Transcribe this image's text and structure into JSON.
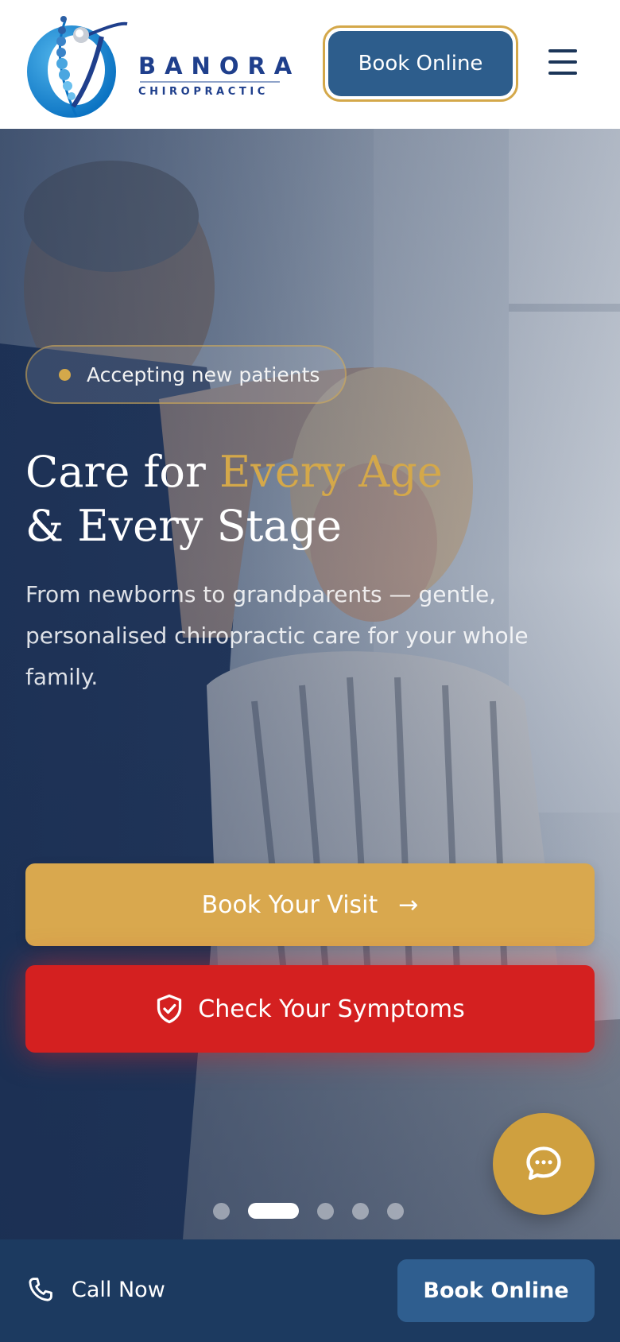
{
  "header": {
    "logo": {
      "name": "BANORA",
      "subtitle": "CHIROPRACTIC"
    },
    "book_label": "Book Online",
    "menu_icon": "hamburger-menu-icon"
  },
  "hero": {
    "badge": {
      "text": "Accepting new patients",
      "dot_color": "#d4a84a"
    },
    "headline": {
      "part1": "Care for ",
      "highlight": "Every Age",
      "part2": "& Every Stage"
    },
    "subtext": "From newborns to grandparents — gentle, personalised chiropractic care for your whole family.",
    "cta_primary": {
      "label": "Book Your Visit",
      "icon": "arrow-right-icon"
    },
    "cta_secondary": {
      "label": "Check Your Symptoms",
      "icon": "shield-check-icon"
    },
    "carousel": {
      "total": 5,
      "active": 2
    },
    "chat_icon": "chat-bubble-icon"
  },
  "bottom_bar": {
    "call_label": "Call Now",
    "call_icon": "phone-icon",
    "book_label": "Book Online"
  },
  "colors": {
    "brand_navy": "#1c3a60",
    "brand_blue": "#2d5d8c",
    "gold": "#d4a84a",
    "alert_red": "#d42020"
  }
}
